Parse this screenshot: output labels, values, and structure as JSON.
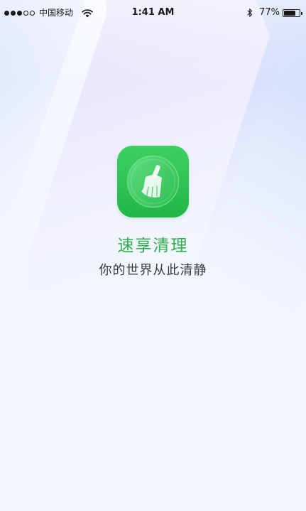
{
  "status_bar": {
    "carrier": "中国移动",
    "time": "1:41 AM",
    "battery_percent": "77%",
    "battery_level": 0.77,
    "signal_bars_filled": 3,
    "signal_bars_total": 5,
    "icons": [
      "wifi-icon",
      "bluetooth-icon",
      "battery-icon"
    ]
  },
  "splash": {
    "app_name": "速享清理",
    "tagline": "你的世界从此清静",
    "icon": "broom-icon"
  },
  "colors": {
    "brand_green": "#2bb24c",
    "icon_green": "#30c255",
    "text_dark": "#3a3a3a",
    "background": "#f4f7ff"
  }
}
